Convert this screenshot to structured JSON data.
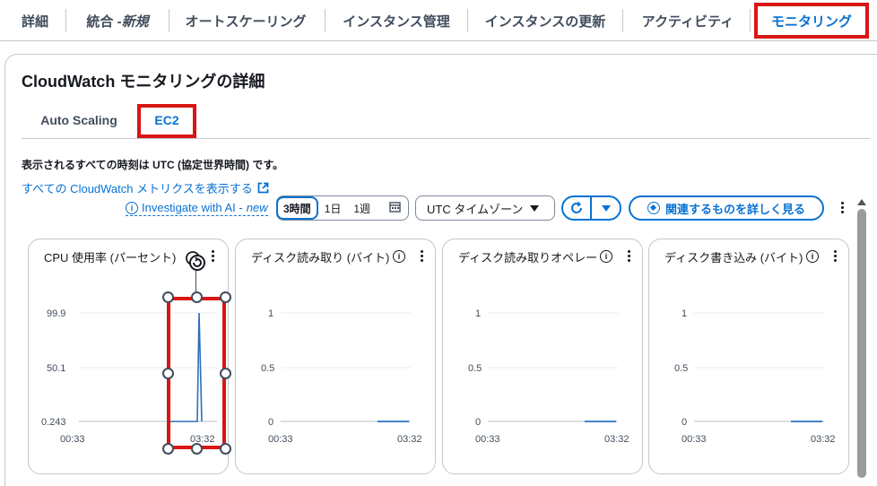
{
  "top_tabs": [
    {
      "label": "詳細"
    },
    {
      "label": "統合 - ",
      "label_italic": "新規"
    },
    {
      "label": "オートスケーリング"
    },
    {
      "label": "インスタンス管理"
    },
    {
      "label": "インスタンスの更新"
    },
    {
      "label": "アクティビティ"
    },
    {
      "label": "モニタリング",
      "active": true
    }
  ],
  "section_title": "CloudWatch モニタリングの詳細",
  "sub_tabs": [
    {
      "label": "Auto Scaling"
    },
    {
      "label": "EC2",
      "active": true
    }
  ],
  "utc_note": "表示されるすべての時刻は UTC (協定世界時間) です。",
  "cloudwatch_link": "すべての CloudWatch メトリクスを表示する",
  "investigate": {
    "label": "Investigate with AI - ",
    "badge": "new"
  },
  "time_range": {
    "options": [
      "3時間",
      "1日",
      "1週"
    ],
    "selected": "3時間"
  },
  "timezone": "UTC タイムゾーン",
  "explore_button": "関連するものを詳しく見る",
  "colors": {
    "accent": "#0972d3",
    "highlight": "#d91515",
    "series": "#2c6fbb"
  },
  "charts": [
    {
      "title": "CPU 使用率 (パーセント)",
      "y_ticks": [
        "99.9",
        "50.1",
        "0.243"
      ],
      "x_ticks": [
        "00:33",
        "03:32"
      ]
    },
    {
      "title": "ディスク読み取り (バイト)",
      "y_ticks": [
        "1",
        "0.5",
        "0"
      ],
      "x_ticks": [
        "00:33",
        "03:32"
      ]
    },
    {
      "title": "ディスク読み取りオペレー",
      "y_ticks": [
        "1",
        "0.5",
        "0"
      ],
      "x_ticks": [
        "00:33",
        "03:32"
      ]
    },
    {
      "title": "ディスク書き込み (バイト)",
      "y_ticks": [
        "1",
        "0.5",
        "0"
      ],
      "x_ticks": [
        "00:33",
        "03:32"
      ]
    }
  ]
}
